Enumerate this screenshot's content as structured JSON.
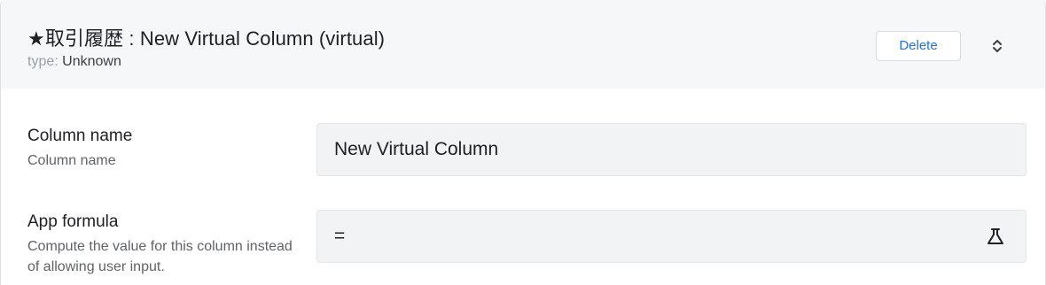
{
  "header": {
    "title": "★取引履歴 : New Virtual Column (virtual)",
    "type_key": "type:",
    "type_value": "Unknown",
    "delete_label": "Delete",
    "expand_icon": "chevron-up-down-icon"
  },
  "fields": {
    "column_name": {
      "label": "Column name",
      "description": "Column name",
      "value": "New Virtual Column"
    },
    "app_formula": {
      "label": "App formula",
      "description": "Compute the value for this column instead of allowing user input.",
      "value": "=",
      "test_icon": "flask-icon"
    }
  },
  "colors": {
    "header_bg": "#f6f7f8",
    "field_bg": "#f1f3f4",
    "accent": "#1a73e8"
  }
}
